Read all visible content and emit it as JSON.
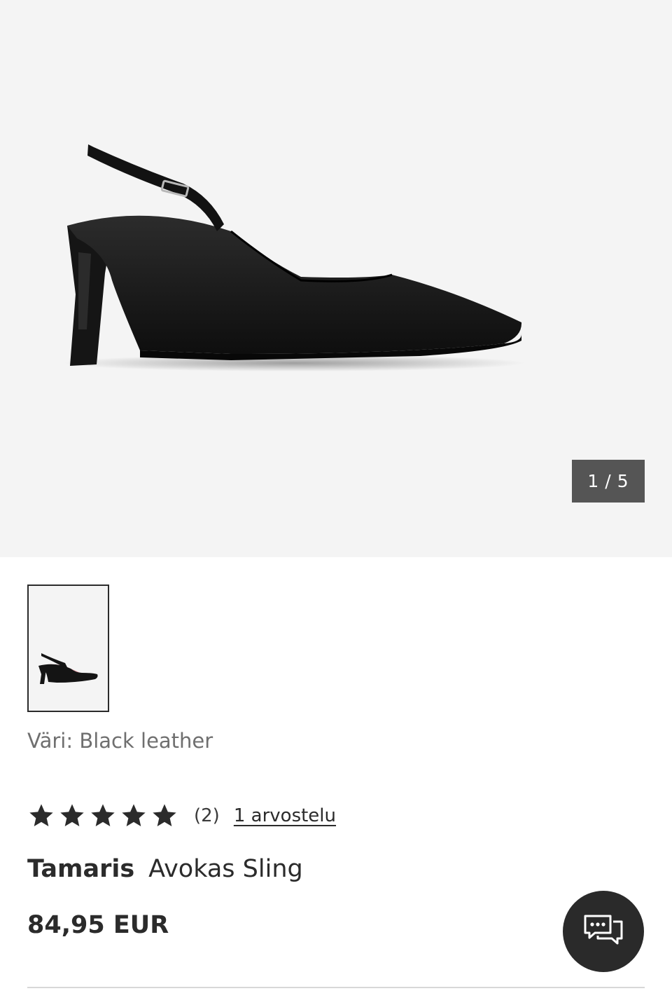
{
  "gallery": {
    "counter_current": "1",
    "counter_separator": "/",
    "counter_total": "5",
    "image_icon": "black-slingback-shoe-image"
  },
  "product": {
    "color_label": "Väri: Black leather",
    "rating_value": 5,
    "rating_max": 5,
    "rating_count": "(2)",
    "reviews_link": "1 arvostelu",
    "brand": "Tamaris",
    "name": "Avokas Sling",
    "price": "84,95 EUR"
  },
  "chat": {
    "icon": "chat-icon"
  },
  "colors": {
    "accent_dark": "#2a2a2a",
    "counter_bg": "#555555",
    "hero_bg": "#f4f4f4"
  }
}
